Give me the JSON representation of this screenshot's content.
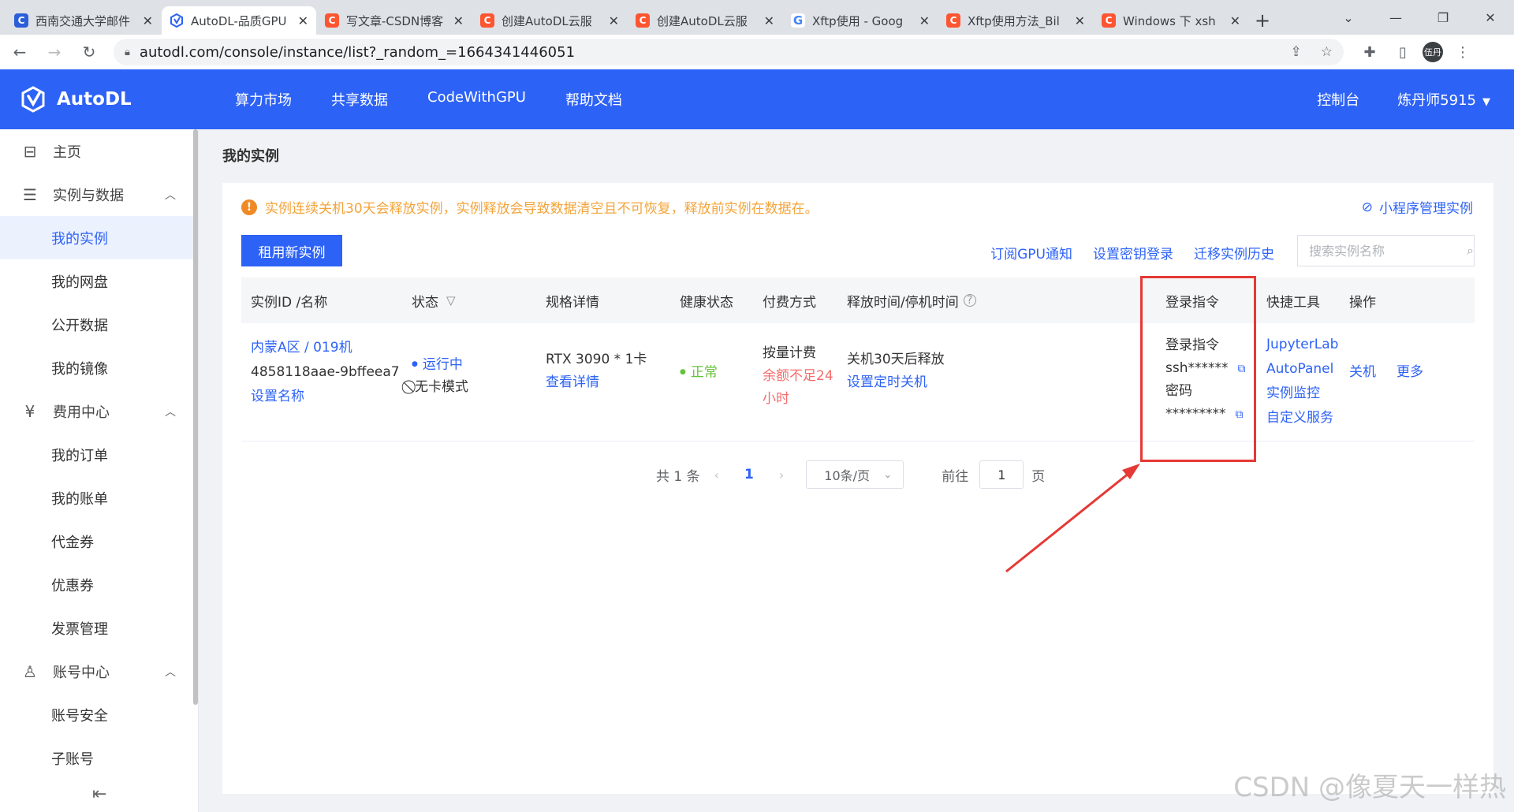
{
  "browser": {
    "tabs": [
      {
        "title": "西南交通大学邮件",
        "icon": "blue"
      },
      {
        "title": "AutoDL-品质GPU",
        "icon": "autodl",
        "active": true
      },
      {
        "title": "写文章-CSDN博客",
        "icon": "csdn"
      },
      {
        "title": "创建AutoDL云服",
        "icon": "csdn"
      },
      {
        "title": "创建AutoDL云服",
        "icon": "csdn"
      },
      {
        "title": "Xftp使用 - Goog",
        "icon": "google"
      },
      {
        "title": "Xftp使用方法_Bil",
        "icon": "csdn"
      },
      {
        "title": "Windows 下 xsh",
        "icon": "csdn"
      }
    ],
    "url": "autodl.com/console/instance/list?_random_=1664341446051",
    "profile_avatar": "伍丹"
  },
  "header": {
    "logo": "AutoDL",
    "nav": [
      "算力市场",
      "共享数据",
      "CodeWithGPU",
      "帮助文档"
    ],
    "console": "控制台",
    "user": "炼丹师5915"
  },
  "sidebar": {
    "home": "主页",
    "group_instances": "实例与数据",
    "my_instances": "我的实例",
    "my_disk": "我的网盘",
    "public_data": "公开数据",
    "my_images": "我的镜像",
    "group_billing": "费用中心",
    "my_orders": "我的订单",
    "my_bills": "我的账单",
    "vouchers": "代金券",
    "coupons": "优惠券",
    "invoices": "发票管理",
    "group_account": "账号中心",
    "account_security": "账号安全",
    "sub_accounts": "子账号"
  },
  "page": {
    "title": "我的实例",
    "notice": "实例连续关机30天会释放实例，实例释放会导致数据清空且不可恢复，释放前实例在数据在。",
    "mini_program_link": "小程序管理实例",
    "rent_button": "租用新实例",
    "links": [
      "订阅GPU通知",
      "设置密钥登录",
      "迁移实例历史"
    ],
    "search_placeholder": "搜索实例名称"
  },
  "table": {
    "headers": {
      "id": "实例ID /名称",
      "status": "状态",
      "spec": "规格详情",
      "health": "健康状态",
      "billing": "付费方式",
      "release": "释放时间/停机时间",
      "login": "登录指令",
      "tools": "快捷工具",
      "ops": "操作"
    },
    "row": {
      "region": "内蒙A区 / 019机",
      "instance_id": "4858118aae-9bffeea7",
      "set_name": "设置名称",
      "status": "运行中",
      "mode": "无卡模式",
      "gpu": "RTX 3090 * 1卡",
      "view_details": "查看详情",
      "health": "正常",
      "billing": "按量计费",
      "balance_warning_1": "余额不足24",
      "balance_warning_2": "小时",
      "release_info": "关机30天后释放",
      "set_timer": "设置定时关机",
      "login_label": "登录指令",
      "ssh": "ssh******",
      "password_label": "密码",
      "password": "*********",
      "tools": [
        "JupyterLab",
        "AutoPanel",
        "实例监控",
        "自定义服务"
      ],
      "shutdown": "关机",
      "more": "更多"
    }
  },
  "pagination": {
    "total": "共 1 条",
    "current_page": "1",
    "page_size": "10条/页",
    "goto_label": "前往",
    "goto_value": "1",
    "page_suffix": "页"
  },
  "watermark": "CSDN @像夏天一样热",
  "colors": {
    "brand": "#2d62f6",
    "warning": "#f3a43a",
    "danger": "#f56c6c",
    "success": "#67c23a",
    "annotation_red": "#e53935"
  }
}
